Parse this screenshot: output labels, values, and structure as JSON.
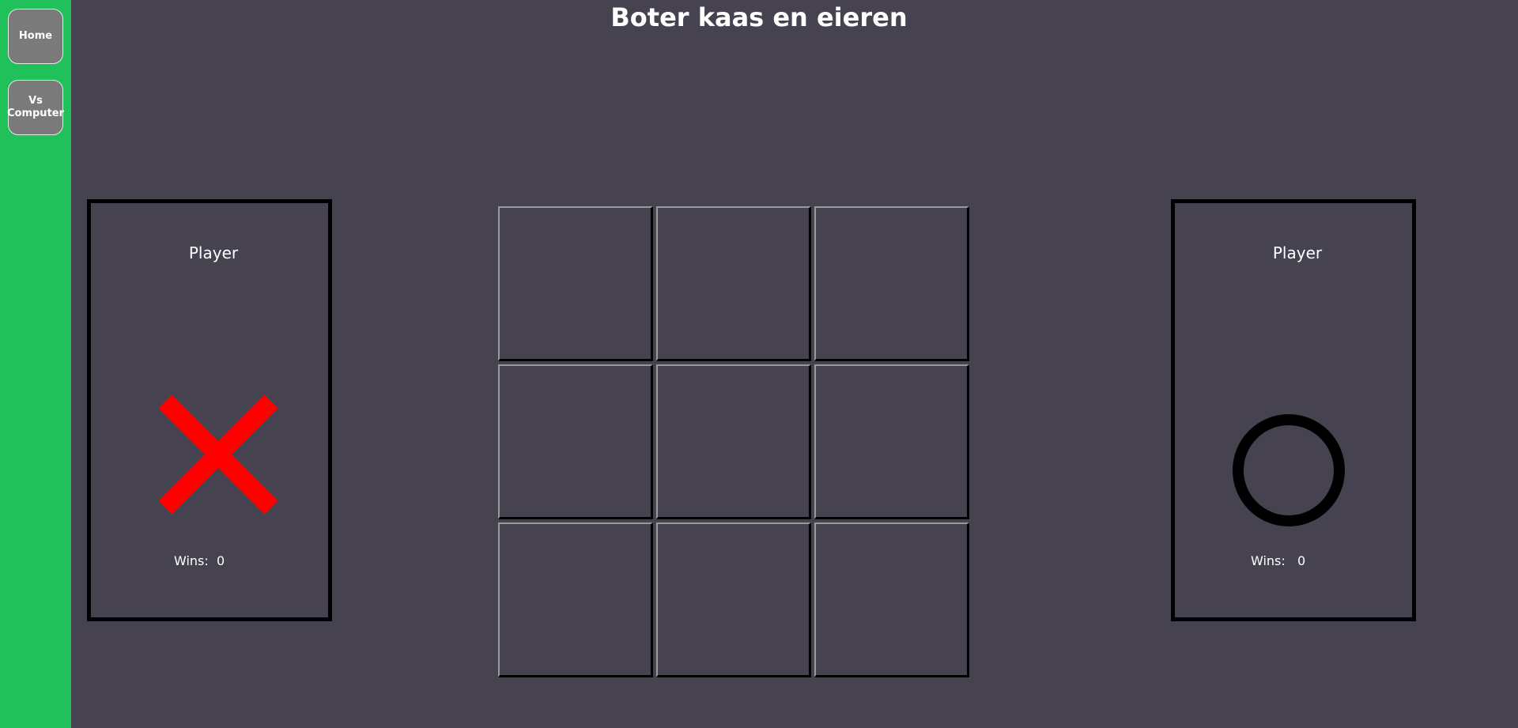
{
  "title": "Boter kaas en eieren",
  "nav": {
    "home_label": "Home",
    "vs_computer_label": "Vs Computer"
  },
  "players": [
    {
      "name": "Player",
      "wins_label": "Wins:",
      "wins": "0",
      "mark": "x-mark-icon",
      "mark_color": "#ff0000"
    },
    {
      "name": "Player",
      "wins_label": "Wins:",
      "wins": "0",
      "mark": "o-mark-icon",
      "mark_color": "#000000"
    }
  ],
  "board": {
    "cells": [
      "",
      "",
      "",
      "",
      "",
      "",
      "",
      "",
      ""
    ]
  },
  "colors": {
    "background": "#464250",
    "sidebar": "#20c05a",
    "button": "#7a7a7a",
    "text": "#ffffff"
  }
}
